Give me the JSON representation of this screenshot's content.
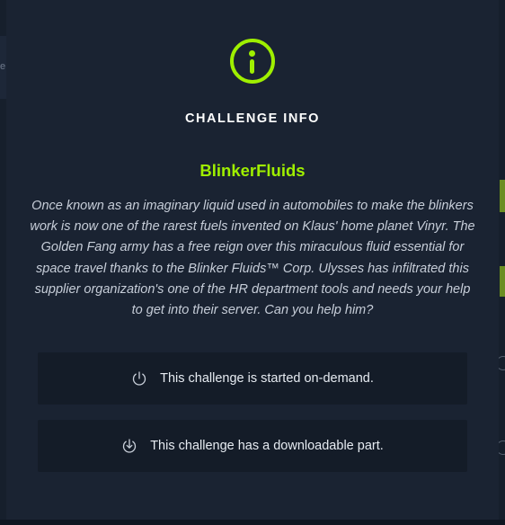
{
  "background": {
    "edge_char": "e"
  },
  "modal": {
    "icon": "info-circle-icon",
    "title": "CHALLENGE INFO",
    "challenge_name": "BlinkerFluids",
    "description": "Once known as an imaginary liquid used in automobiles to make the blinkers work is now one of the rarest fuels invented on Klaus' home planet Vinyr. The Golden Fang army has a free reign over this miraculous fluid essential for space travel thanks to the Blinker Fluids™ Corp. Ulysses has infiltrated this supplier organization's one of the HR department tools and needs your help to get into their server. Can you help him?",
    "info_items": [
      {
        "icon": "power-icon",
        "text": "This challenge is started on-demand."
      },
      {
        "icon": "download-icon",
        "text": "This challenge has a downloadable part."
      }
    ]
  },
  "colors": {
    "accent": "#9fef00",
    "modal_bg": "#1a2332",
    "box_bg": "#141c28",
    "text": "#ffffff",
    "muted_text": "#c6cdd8"
  }
}
